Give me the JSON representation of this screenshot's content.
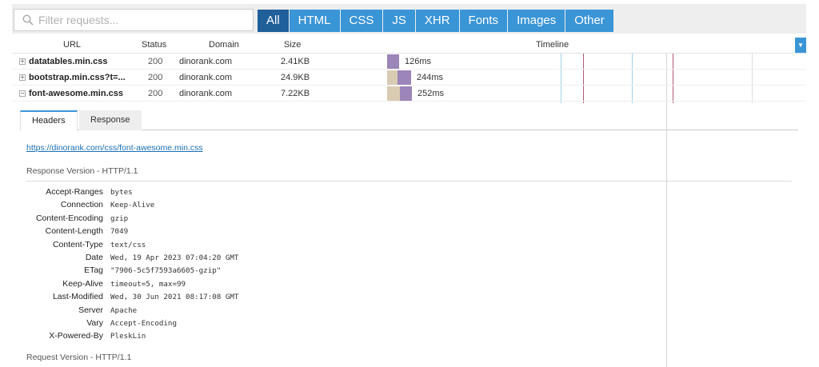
{
  "filter": {
    "placeholder": "Filter requests..."
  },
  "type_tabs": [
    {
      "label": "All",
      "active": true
    },
    {
      "label": "HTML",
      "active": false
    },
    {
      "label": "CSS",
      "active": false
    },
    {
      "label": "JS",
      "active": false
    },
    {
      "label": "XHR",
      "active": false
    },
    {
      "label": "Fonts",
      "active": false
    },
    {
      "label": "Images",
      "active": false
    },
    {
      "label": "Other",
      "active": false
    }
  ],
  "columns": {
    "url": "URL",
    "status": "Status",
    "domain": "Domain",
    "size": "Size",
    "timeline": "Timeline"
  },
  "requests": [
    {
      "toggle": "+",
      "url": "datatables.min.css",
      "status": "200",
      "domain": "dinorank.com",
      "size": "2.41KB",
      "duration": "126ms"
    },
    {
      "toggle": "+",
      "url": "bootstrap.min.css?t=...",
      "status": "200",
      "domain": "dinorank.com",
      "size": "24.9KB",
      "duration": "244ms"
    },
    {
      "toggle": "−",
      "url": "font-awesome.min.css",
      "status": "200",
      "domain": "dinorank.com",
      "size": "7.22KB",
      "duration": "252ms"
    }
  ],
  "detail": {
    "tabs": {
      "headers": "Headers",
      "response": "Response"
    },
    "request_url": "https://dinorank.com/css/font-awesome.min.css",
    "response_version": "Response Version - HTTP/1.1",
    "response_headers": [
      {
        "name": "Accept-Ranges",
        "value": "bytes"
      },
      {
        "name": "Connection",
        "value": "Keep-Alive"
      },
      {
        "name": "Content-Encoding",
        "value": "gzip"
      },
      {
        "name": "Content-Length",
        "value": "7049"
      },
      {
        "name": "Content-Type",
        "value": "text/css"
      },
      {
        "name": "Date",
        "value": "Wed, 19 Apr 2023 07:04:20 GMT"
      },
      {
        "name": "ETag",
        "value": "\"7906-5c5f7593a6605-gzip\""
      },
      {
        "name": "Keep-Alive",
        "value": "timeout=5, max=99"
      },
      {
        "name": "Last-Modified",
        "value": "Wed, 30 Jun 2021 08:17:08 GMT"
      },
      {
        "name": "Server",
        "value": "Apache"
      },
      {
        "name": "Vary",
        "value": "Accept-Encoding"
      },
      {
        "name": "X-Powered-By",
        "value": "PleskLin"
      }
    ],
    "request_version": "Request Version - HTTP/1.1"
  },
  "colors": {
    "accent": "#3a95d6",
    "active_tab": "#1f5f9a",
    "wait_bar": "#d9cbb2",
    "receive_bar": "#9c85b8",
    "link": "#1a6fb4"
  }
}
